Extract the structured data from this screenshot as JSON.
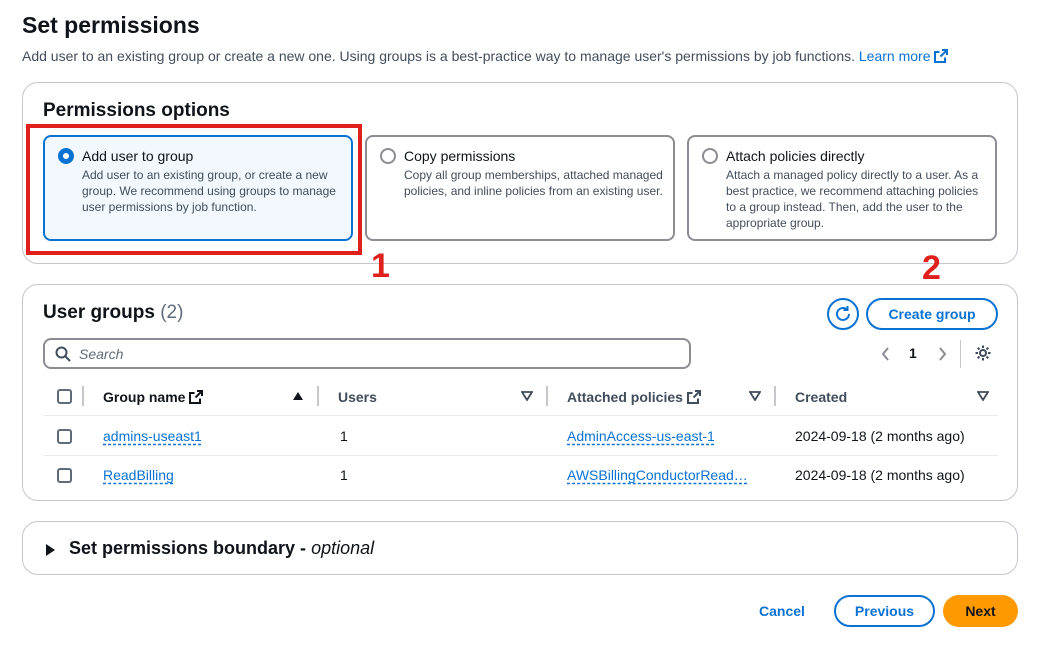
{
  "header": {
    "title": "Set permissions",
    "description": "Add user to an existing group or create a new one. Using groups is a best-practice way to manage user's permissions by job functions.",
    "learn_more": "Learn more"
  },
  "permissions_options": {
    "heading": "Permissions options",
    "options": [
      {
        "label": "Add user to group",
        "description": "Add user to an existing group, or create a new group. We recommend using groups to manage user permissions by job function.",
        "selected": true
      },
      {
        "label": "Copy permissions",
        "description": "Copy all group memberships, attached managed policies, and inline policies from an existing user.",
        "selected": false
      },
      {
        "label": "Attach policies directly",
        "description": "Attach a managed policy directly to a user. As a best practice, we recommend attaching policies to a group instead. Then, add the user to the appropriate group.",
        "selected": false
      }
    ]
  },
  "annotations": {
    "marker_1": "1",
    "marker_2": "2"
  },
  "user_groups": {
    "heading": "User groups",
    "count": "(2)",
    "create_button": "Create group",
    "search_placeholder": "Search",
    "page": "1",
    "columns": [
      "Group name",
      "Users",
      "Attached policies",
      "Created"
    ],
    "rows": [
      {
        "name": "admins-useast1",
        "users": "1",
        "policies": "AdminAccess-us-east-1",
        "created": "2024-09-18 (2 months ago)"
      },
      {
        "name": "ReadBilling",
        "users": "1",
        "policies": "AWSBillingConductorRead…",
        "created": "2024-09-18 (2 months ago)"
      }
    ]
  },
  "boundary": {
    "label": "Set permissions boundary - ",
    "optional": "optional"
  },
  "footer": {
    "cancel": "Cancel",
    "previous": "Previous",
    "next": "Next"
  },
  "colors": {
    "accent": "#0972d3",
    "primary_button": "#ff9900",
    "annotation_red": "#e0201c"
  }
}
